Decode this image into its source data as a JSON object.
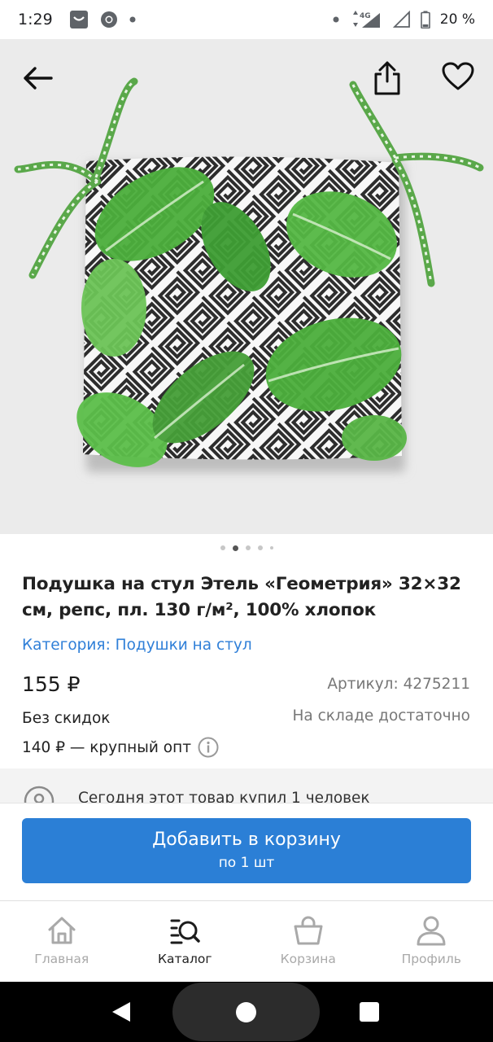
{
  "status_bar": {
    "time": "1:29",
    "network": "4G",
    "battery": "20 %",
    "icons": [
      "inbox-icon",
      "chrome-icon",
      "dot-icon",
      "dot-icon",
      "signal-icon",
      "wifi-off-icon",
      "battery-icon"
    ]
  },
  "hero": {
    "icons": [
      "back-arrow-icon",
      "share-icon",
      "heart-icon"
    ],
    "carousel": {
      "count": 5,
      "active_index": 1
    }
  },
  "product": {
    "title": "Подушка на стул Этель «Геометрия» 32×32 см, репс, пл. 130 г/м², 100% хлопок",
    "category": "Категория: Подушки на стул",
    "price": "155 ₽",
    "sku": "Артикул: 4275211",
    "discount": "Без скидок",
    "stock": "На складе достаточно",
    "wholesale": "140 ₽ — крупный опт"
  },
  "purchased": {
    "text": "Сегодня этот товар купил 1 человек"
  },
  "cart_button": {
    "label": "Добавить в корзину",
    "sublabel": "по 1 шт"
  },
  "bottom_nav": {
    "items": [
      {
        "label": "Главная",
        "icon": "home-icon",
        "active": false
      },
      {
        "label": "Каталог",
        "icon": "catalog-search-icon",
        "active": true
      },
      {
        "label": "Корзина",
        "icon": "basket-icon",
        "active": false
      },
      {
        "label": "Профиль",
        "icon": "profile-icon",
        "active": false
      }
    ]
  },
  "colors": {
    "accent": "#2b7fd6",
    "link": "#2f7fd8",
    "leaf_green": "#4caf3c",
    "image_bg": "#ebebeb"
  }
}
